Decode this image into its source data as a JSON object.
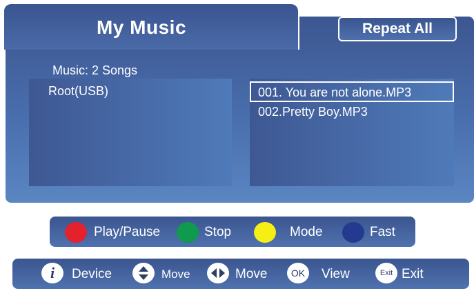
{
  "header": {
    "title": "My Music",
    "repeat_label": "Repeat All"
  },
  "browser": {
    "count_label": "Music:  2 Songs",
    "root_label": "Root(USB)",
    "songs": [
      {
        "label": "001. You are not alone.MP3",
        "selected": true
      },
      {
        "label": "002.Pretty Boy.MP3",
        "selected": false
      }
    ]
  },
  "controls": {
    "play_pause": "Play/Pause",
    "stop": "Stop",
    "mode": "Mode",
    "fast": "Fast",
    "colors": {
      "red": "#e3222e",
      "green": "#0f9a4e",
      "yellow": "#f6ef16",
      "blue": "#243a8e"
    }
  },
  "nav": {
    "info_icon_text": "i",
    "device": "Device",
    "move_ud": "Move",
    "move_lr": "Move",
    "ok_icon_text": "OK",
    "view": "View",
    "exit_icon_text": "Exit",
    "exit": "Exit"
  },
  "theme": {
    "panel_blue": "#4a6fae",
    "dark_blue": "#3b5590",
    "text": "#ffffff"
  }
}
